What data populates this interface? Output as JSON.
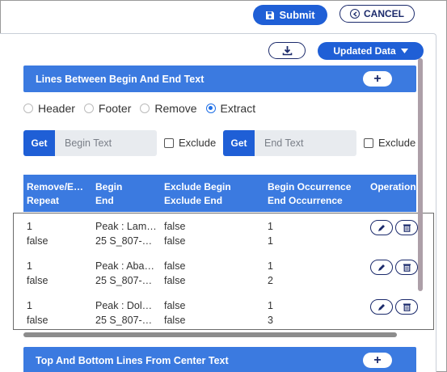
{
  "toolbar": {
    "submit_label": "Submit",
    "cancel_label": "CANCEL"
  },
  "panel": {
    "updated_data_label": "Updated Data"
  },
  "section1": {
    "title": "Lines Between Begin And End Text",
    "radios": [
      {
        "label": "Header",
        "checked": false
      },
      {
        "label": "Footer",
        "checked": false
      },
      {
        "label": "Remove",
        "checked": false
      },
      {
        "label": "Extract",
        "checked": true
      }
    ],
    "begin": {
      "get_label": "Get",
      "placeholder": "Begin Text",
      "exclude_label": "Exclude"
    },
    "end": {
      "get_label": "Get",
      "placeholder": "End Text",
      "exclude_label": "Exclude"
    }
  },
  "table": {
    "headers": [
      {
        "line1": "Remove/E…",
        "line2": "Repeat"
      },
      {
        "line1": "Begin",
        "line2": "End"
      },
      {
        "line1": "Exclude Begin",
        "line2": "Exclude End"
      },
      {
        "line1": "Begin Occurrence",
        "line2": "End Occurrence"
      },
      {
        "line1": "Operation",
        "line2": ""
      }
    ],
    "rows": [
      {
        "remove": "1",
        "repeat": "false",
        "begin": "Peak : Lam…",
        "end": "25 S_807-…",
        "excl_begin": "false",
        "excl_end": "false",
        "begin_occ": "1",
        "end_occ": "1"
      },
      {
        "remove": "1",
        "repeat": "false",
        "begin": "Peak : Aba…",
        "end": "25 S_807-…",
        "excl_begin": "false",
        "excl_end": "false",
        "begin_occ": "1",
        "end_occ": "2"
      },
      {
        "remove": "1",
        "repeat": "false",
        "begin": "Peak : Dol…",
        "end": "25 S_807-…",
        "excl_begin": "false",
        "excl_end": "false",
        "begin_occ": "1",
        "end_occ": "3"
      }
    ]
  },
  "section2": {
    "title": "Top And Bottom Lines From Center Text"
  },
  "colors": {
    "primary": "#1f5fd6",
    "section": "#3b7ae0",
    "navy": "#1b2a6b"
  }
}
